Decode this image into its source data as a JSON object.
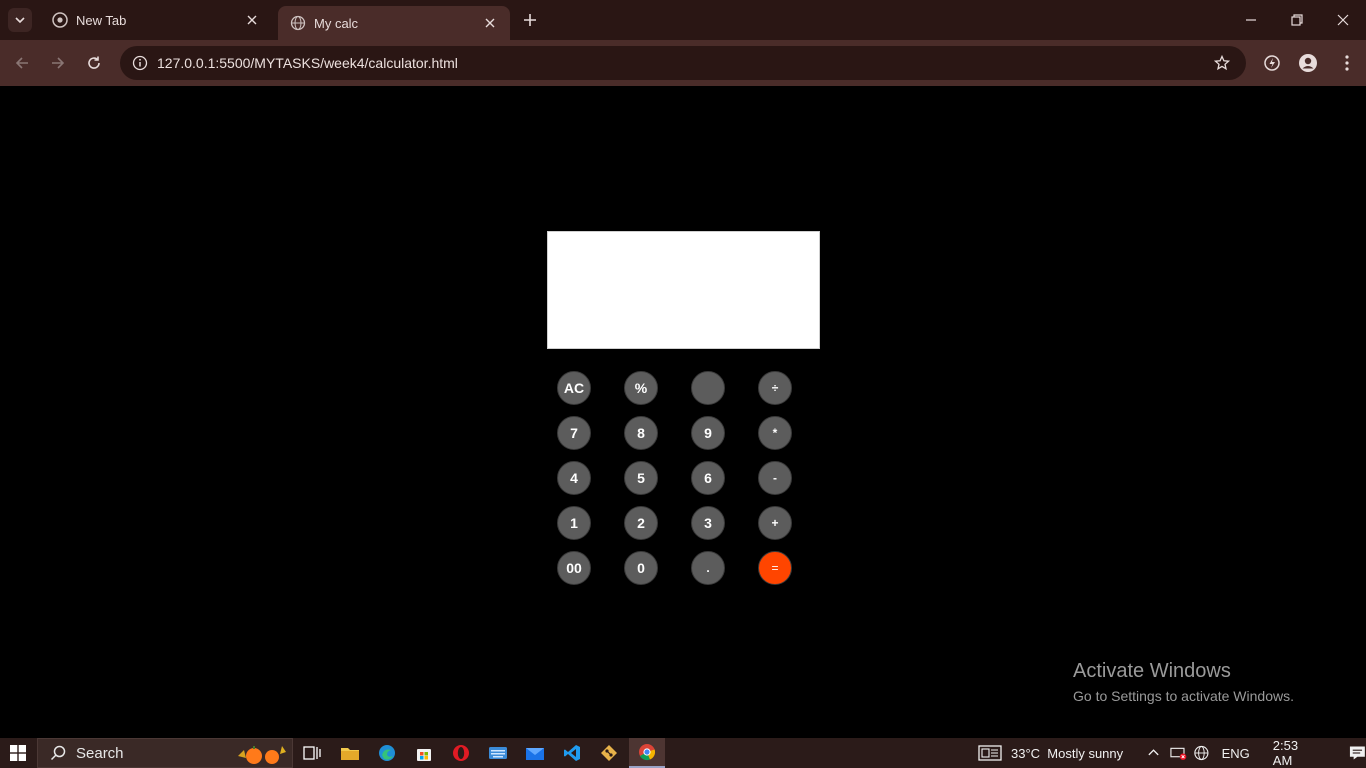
{
  "browser": {
    "tabs": [
      {
        "title": "New Tab",
        "active": false
      },
      {
        "title": "My calc",
        "active": true
      }
    ],
    "url": "127.0.0.1:5500/MYTASKS/week4/calculator.html"
  },
  "calculator": {
    "display_value": "",
    "rows": [
      [
        "AC",
        "%",
        "",
        "÷"
      ],
      [
        "7",
        "8",
        "9",
        "*"
      ],
      [
        "4",
        "5",
        "6",
        "-"
      ],
      [
        "1",
        "2",
        "3",
        "+"
      ],
      [
        "00",
        "0",
        ".",
        "="
      ]
    ],
    "key_color": "#5c5c5c",
    "equals_color": "#ff4500"
  },
  "watermark": {
    "line1": "Activate Windows",
    "line2": "Go to Settings to activate Windows."
  },
  "taskbar": {
    "search_label": "Search",
    "weather": "33°C  Mostly sunny",
    "language": "ENG",
    "time": "2:53 AM",
    "apps": [
      "task-view",
      "file-explorer",
      "edge",
      "store",
      "opera",
      "keyboard",
      "mail",
      "vscode",
      "git",
      "chrome"
    ]
  }
}
